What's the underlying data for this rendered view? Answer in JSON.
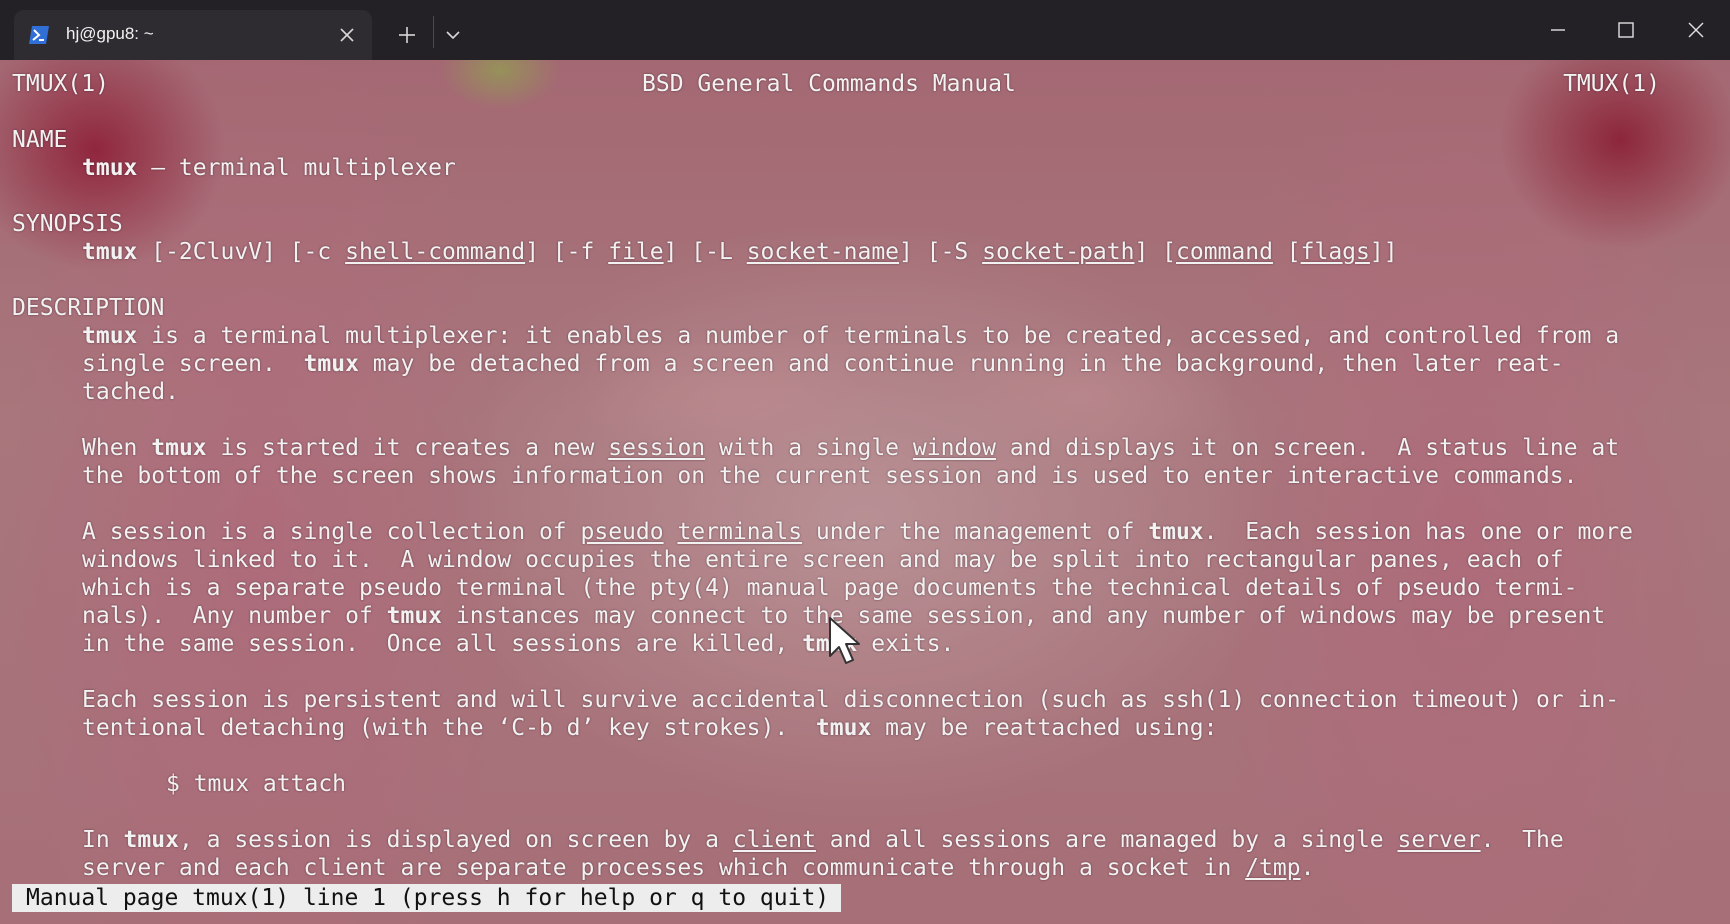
{
  "window": {
    "tab_title": "hj@gpu8: ~",
    "accent": "#3b6fd8"
  },
  "man": {
    "header_left": "TMUX(1)",
    "header_center": "BSD General Commands Manual",
    "header_right": "TMUX(1)",
    "name_heading": "NAME",
    "name_line": {
      "cmd": "tmux",
      "rest": " — terminal multiplexer"
    },
    "synopsis_heading": "SYNOPSIS",
    "synopsis": {
      "cmd": "tmux",
      "t1": " [-2CluvV] [-c ",
      "a1": "shell-command",
      "t2": "] [-f ",
      "a2": "file",
      "t3": "] [-L ",
      "a3": "socket-name",
      "t4": "] [-S ",
      "a4": "socket-path",
      "t5": "] [",
      "a5": "command",
      "t6": " [",
      "a6": "flags",
      "t7": "]]"
    },
    "description_heading": "DESCRIPTION",
    "p1": {
      "l1_b": "tmux",
      "l1_t": " is a terminal multiplexer: it enables a number of terminals to be created, accessed, and controlled from a",
      "l2_t1": "single screen.  ",
      "l2_b": "tmux",
      "l2_t2": " may be detached from a screen and continue running in the background, then later reat-",
      "l3": "tached."
    },
    "p2": {
      "l1_t1": "When ",
      "l1_b": "tmux",
      "l1_t2": " is started it creates a new ",
      "l1_u1": "session",
      "l1_t3": " with a single ",
      "l1_u2": "window",
      "l1_t4": " and displays it on screen.  A status line at",
      "l2": "the bottom of the screen shows information on the current session and is used to enter interactive commands."
    },
    "p3": {
      "l1_t1": "A session is a single collection of ",
      "l1_u1": "pseudo",
      "l1_t2": " ",
      "l1_u2": "terminals",
      "l1_t3": " under the management of ",
      "l1_b": "tmux",
      "l1_t4": ".  Each session has one or more",
      "l2": "windows linked to it.  A window occupies the entire screen and may be split into rectangular panes, each of",
      "l3": "which is a separate pseudo terminal (the pty(4) manual page documents the technical details of pseudo termi-",
      "l4_t1": "nals).  Any number of ",
      "l4_b": "tmux",
      "l4_t2": " instances may connect to the same session, and any number of windows may be present",
      "l5_t1": "in the same session.  Once all sessions are killed, ",
      "l5_b": "tmux",
      "l5_t2": " exits."
    },
    "p4": {
      "l1": "Each session is persistent and will survive accidental disconnection (such as ssh(1) connection timeout) or in-",
      "l2_t1": "tentional detaching (with the ‘C-b d’ key strokes).  ",
      "l2_b": "tmux",
      "l2_t2": " may be reattached using:"
    },
    "example": "$ tmux attach",
    "p5": {
      "l1_t1": "In ",
      "l1_b": "tmux",
      "l1_t2": ", a session is displayed on screen by a ",
      "l1_u1": "client",
      "l1_t3": " and all sessions are managed by a single ",
      "l1_u2": "server",
      "l1_t4": ".  The",
      "l2_t1": "server and each client are separate processes which communicate through a socket in ",
      "l2_u": "/tmp",
      "l2_t2": "."
    }
  },
  "status": "Manual page tmux(1) line 1 (press h for help or q to quit)"
}
